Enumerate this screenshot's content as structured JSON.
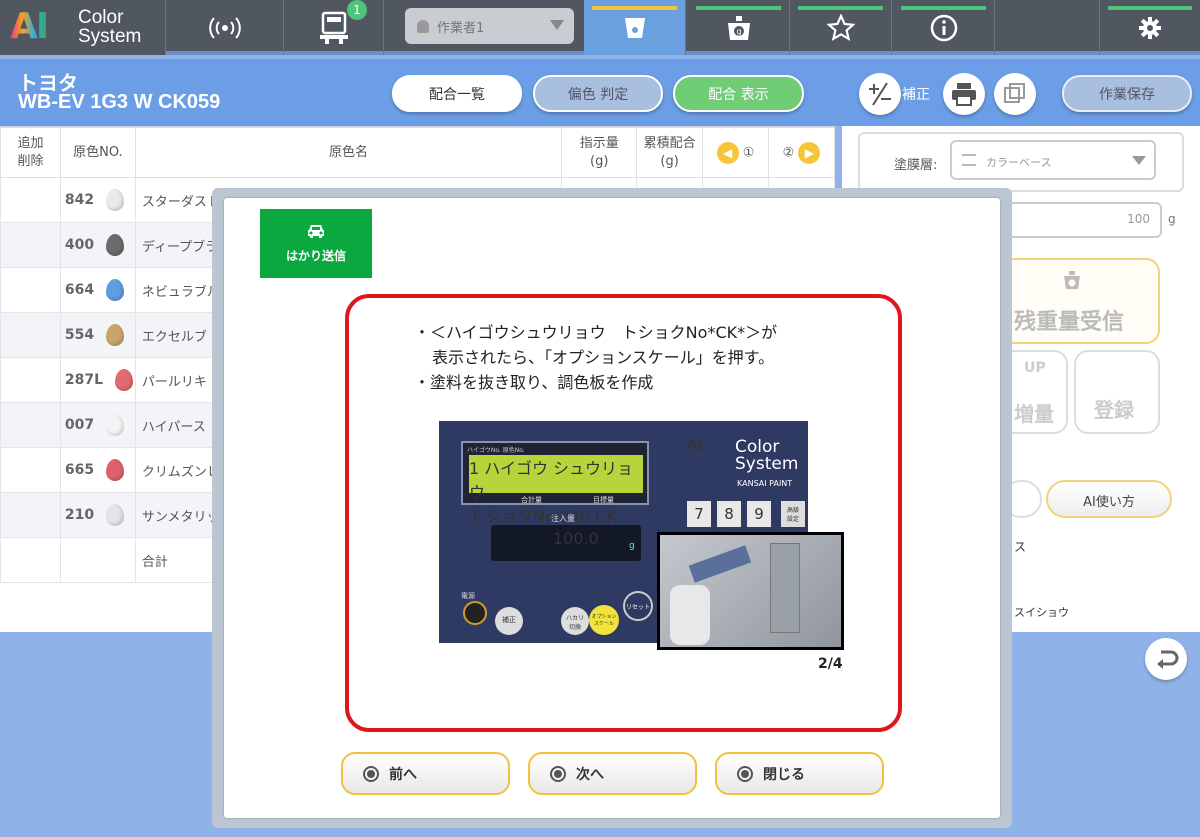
{
  "topbar": {
    "logo_line1": "Color",
    "logo_line2": "System",
    "logo_mark": "AI",
    "badge_count": "1",
    "worker": "作業者1",
    "icons": [
      "wireless-signal-icon",
      "scale-machine-icon",
      "cup-icon",
      "scale-icon",
      "star-icon",
      "info-icon",
      "gear-icon"
    ]
  },
  "header": {
    "maker": "トヨタ",
    "code": "WB-EV 1G3 W CK059",
    "btn_list": "配合一覧",
    "btn_judge": "偏色 判定",
    "btn_show": "配合 表示",
    "btn_correct": "補正",
    "btn_save": "作業保存"
  },
  "table": {
    "headers": {
      "add_del": "追加\n削除",
      "color_no": "原色NO.",
      "color_name": "原色名",
      "instruct": "指示量\n(g)",
      "cumulative": "累積配合\n(g)",
      "c1": "①",
      "c2": "②"
    },
    "rows": [
      {
        "no": "842",
        "name": "スターダスト",
        "color": "#e9eaec"
      },
      {
        "no": "400",
        "name": "ディープブラ",
        "color": "#6b6b6b"
      },
      {
        "no": "664",
        "name": "ネビュラブル",
        "color": "#5f9ee0"
      },
      {
        "no": "554",
        "name": "エクセルブ",
        "color": "#c9a56a"
      },
      {
        "no": "287L",
        "name": "パールリキ",
        "color": "#e26a72"
      },
      {
        "no": "007",
        "name": "ハイパース",
        "color": "#f4f4f4"
      },
      {
        "no": "665",
        "name": "クリムズンレ",
        "color": "#e06070"
      },
      {
        "no": "210",
        "name": "サンメタリッ",
        "color": "#e4e5e7"
      }
    ],
    "total_label": "合計"
  },
  "right_panel": {
    "layer_label": "塗膜層:",
    "layer_value": "カラーベース",
    "amount": "100",
    "amount_unit": "g",
    "receive": "残重量受信",
    "up_label": "UP",
    "up_sub": "増量",
    "register": "登録",
    "ai_usage": "AI使い方",
    "text_fragment1": "ス",
    "text_fragment2": "スイショウ"
  },
  "popup": {
    "send_label": "はかり送信",
    "line1": "・＜ハイゴウシュウリョウ　トショクNo*CK*＞が",
    "line2": "表示されたら、「オプションスケール」を押す。",
    "line3": "・塗料を抜き取り、調色板を作成",
    "photo": {
      "lcd1": "1 ハイゴウ シュウリョウ",
      "lcd2": "トショクNo.040 CK",
      "lcd_head": "ハイゴウNo.  原色No.",
      "label_total": "合計量",
      "label_target": "目標量",
      "label_inject": "注入量",
      "digits": "100.0",
      "unit": "g",
      "brand1": "Color",
      "brand2": "System",
      "brand3": "KANSAI PAINT",
      "keys": [
        "7",
        "8",
        "9"
      ],
      "key_option": "高級\n設定",
      "btn_power": "電源",
      "btn_correct": "補正",
      "btn_hakari": "ハカリ\n切換",
      "btn_option": "オプション\nスケール",
      "btn_reset": "リセット"
    },
    "pager": "2/4",
    "prev": "前へ",
    "next": "次へ",
    "close": "閉じる"
  }
}
